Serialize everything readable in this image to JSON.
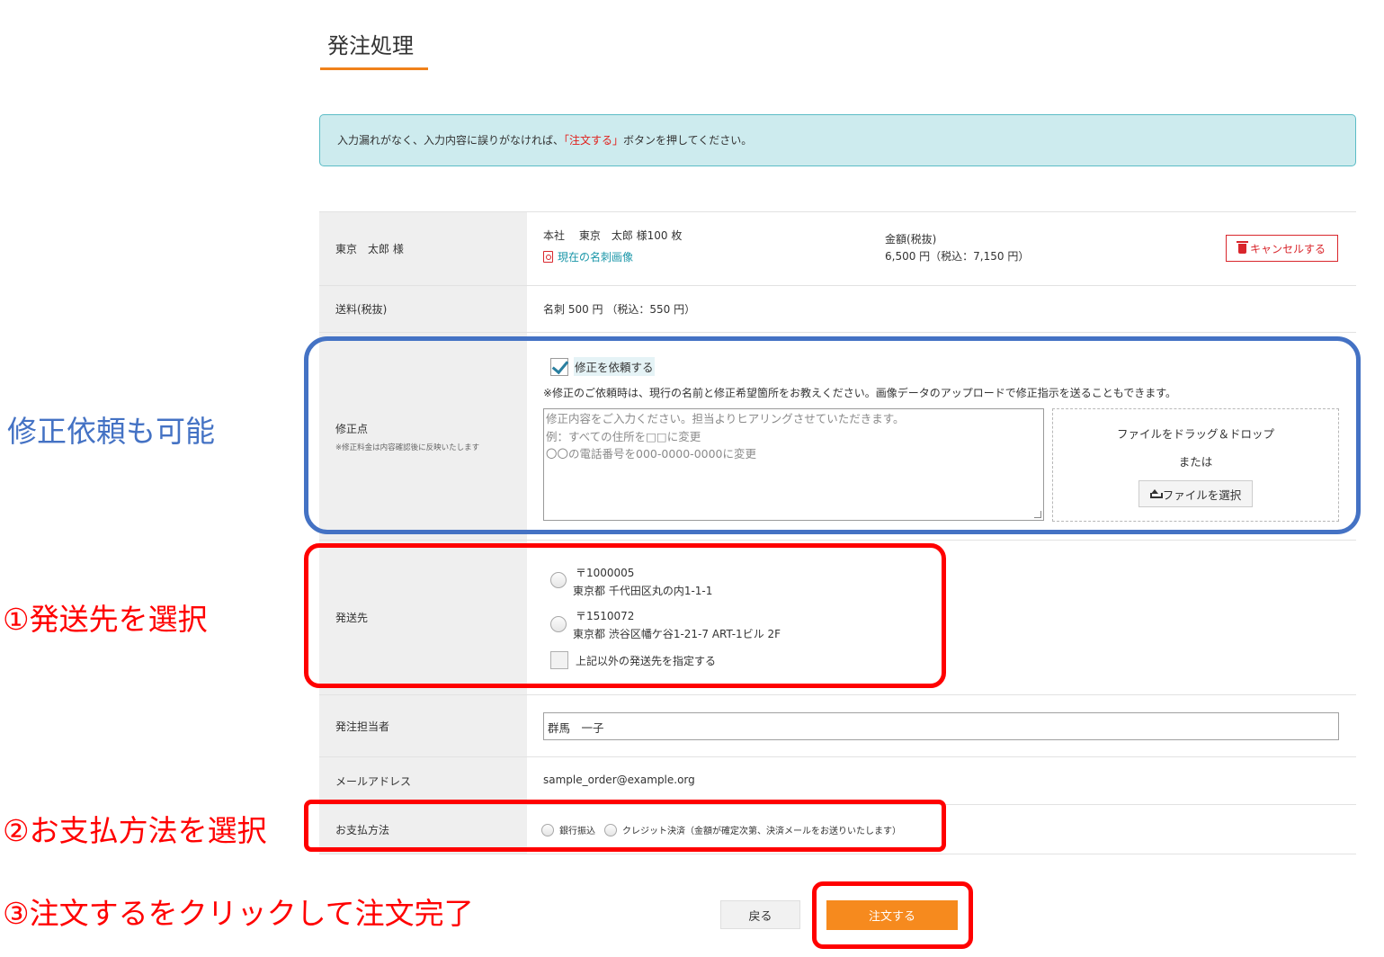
{
  "page_title": "発注処理",
  "notice": {
    "before": "入力漏れがなく、入力内容に誤りがなければ、",
    "highlight": "「注文する」",
    "after": "ボタンを押してください。"
  },
  "order_item": {
    "customer": "東京　太郎 様",
    "description": "本社　 東京　太郎 様100 枚",
    "card_link": "現在の名刺画像",
    "amount_label": "金額(税抜)",
    "amount_value": "6,500 円（税込：7,150 円）",
    "cancel_label": "キャンセルする"
  },
  "shipping_fee": {
    "label": "送料(税抜)",
    "value": "名刺 500 円 （税込：550 円）"
  },
  "correction": {
    "label": "修正点",
    "note": "※修正料金は内容確認後に反映いたします",
    "checkbox_label": "修正を依頼する",
    "checked": true,
    "instruction": "※修正のご依頼時は、現行の名前と修正希望箇所をお教えください。画像データのアップロードで修正指示を送ることもできます。",
    "textarea_placeholder": "修正内容をご入力ください。担当よりヒアリングさせていただきます。\n例：すべての住所を□□に変更\n〇〇の電話番号を000-0000-0000に変更",
    "dropzone_text": "ファイルをドラッグ＆ドロップ",
    "dropzone_or": "または",
    "file_button": "ファイルを選択"
  },
  "destination": {
    "label": "発送先",
    "options": [
      {
        "postal": "〒1000005",
        "address": "東京都 千代田区丸の内1-1-1"
      },
      {
        "postal": "〒1510072",
        "address": "東京都 渋谷区幡ケ谷1-21-7 ART-1ビル 2F"
      }
    ],
    "other_label": "上記以外の発送先を指定する"
  },
  "orderer": {
    "label": "発注担当者",
    "value": "群馬　一子"
  },
  "email": {
    "label": "メールアドレス",
    "value": "sample_order@example.org"
  },
  "payment": {
    "label": "お支払方法",
    "options": [
      "銀行振込",
      "クレジット決済（金額が確定次第、決済メールをお送りいたします）"
    ]
  },
  "buttons": {
    "back": "戻る",
    "order": "注文する"
  },
  "annotations": {
    "correction": "修正依頼も可能",
    "step1": "①発送先を選択",
    "step2": "②お支払方法を選択",
    "step3": "③注文するをクリックして注文完了"
  },
  "colors": {
    "accent": "#f68a1e",
    "notice_bg": "#cdebee",
    "annotation_blue": "#4472c4",
    "annotation_red": "#ff0000",
    "link": "#1a96a8",
    "cancel": "#d9262c"
  }
}
